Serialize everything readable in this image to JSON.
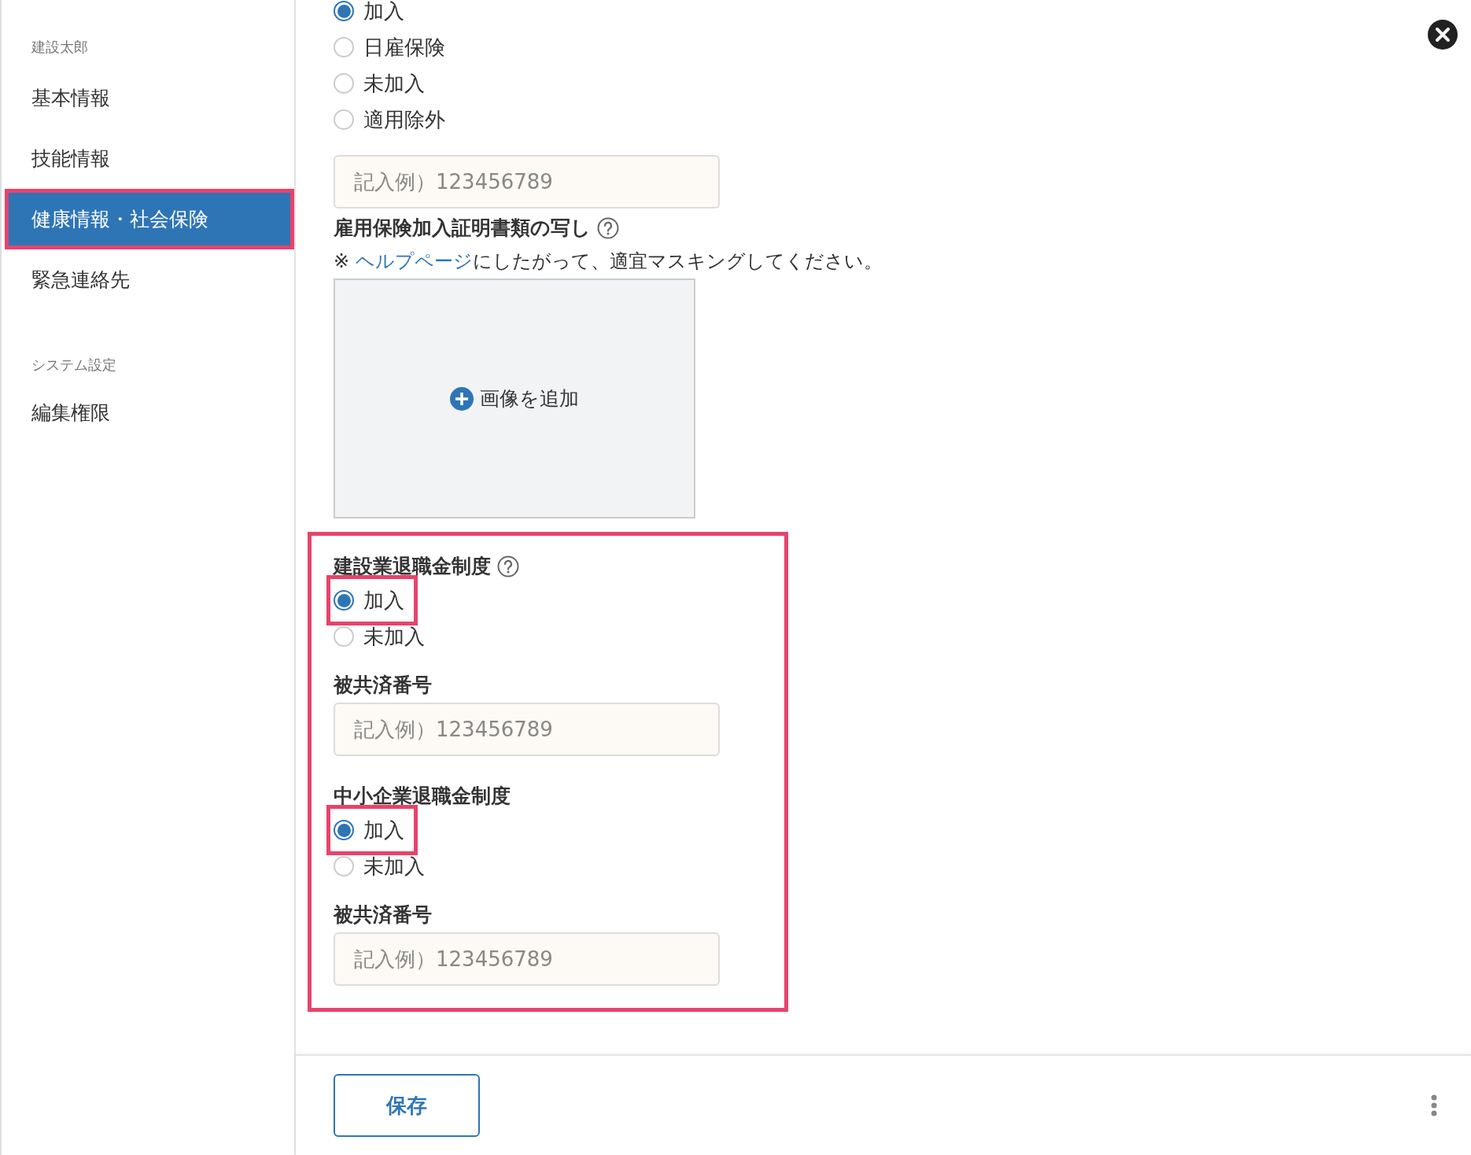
{
  "sidebar": {
    "user": "建設太郎",
    "items": [
      {
        "label": "基本情報",
        "selected": false,
        "highlighted": false
      },
      {
        "label": "技能情報",
        "selected": false,
        "highlighted": false
      },
      {
        "label": "健康情報・社会保険",
        "selected": true,
        "highlighted": true
      },
      {
        "label": "緊急連絡先",
        "selected": false,
        "highlighted": false
      }
    ],
    "section_label": "システム設定",
    "section_items": [
      {
        "label": "編集権限",
        "selected": false,
        "highlighted": false
      }
    ]
  },
  "employment_insurance": {
    "options": [
      {
        "label": "加入",
        "selected": true,
        "highlighted": false
      },
      {
        "label": "日雇保険",
        "selected": false,
        "highlighted": false
      },
      {
        "label": "未加入",
        "selected": false,
        "highlighted": false
      },
      {
        "label": "適用除外",
        "selected": false,
        "highlighted": false
      }
    ],
    "number_field": {
      "placeholder": "記入例）123456789"
    },
    "attachment": {
      "label": "雇用保険加入証明書類の写し",
      "help": true,
      "note_prefix": "※ ",
      "note_link": "ヘルプページ",
      "note_suffix": "にしたがって、適宜マスキングしてください。",
      "upload_button": "画像を追加"
    }
  },
  "retirement": {
    "highlighted": true,
    "groups": [
      {
        "label": "建設業退職金制度",
        "help": true,
        "options": [
          {
            "label": "加入",
            "selected": true,
            "highlighted": true
          },
          {
            "label": "未加入",
            "selected": false,
            "highlighted": false
          }
        ],
        "number_label": "被共済番号",
        "number_field": {
          "placeholder": "記入例）123456789"
        }
      },
      {
        "label": "中小企業退職金制度",
        "help": false,
        "options": [
          {
            "label": "加入",
            "selected": true,
            "highlighted": true
          },
          {
            "label": "未加入",
            "selected": false,
            "highlighted": false
          }
        ],
        "number_label": "被共済番号",
        "number_field": {
          "placeholder": "記入例）123456789"
        }
      }
    ]
  },
  "footer": {
    "save_button": "保存"
  }
}
